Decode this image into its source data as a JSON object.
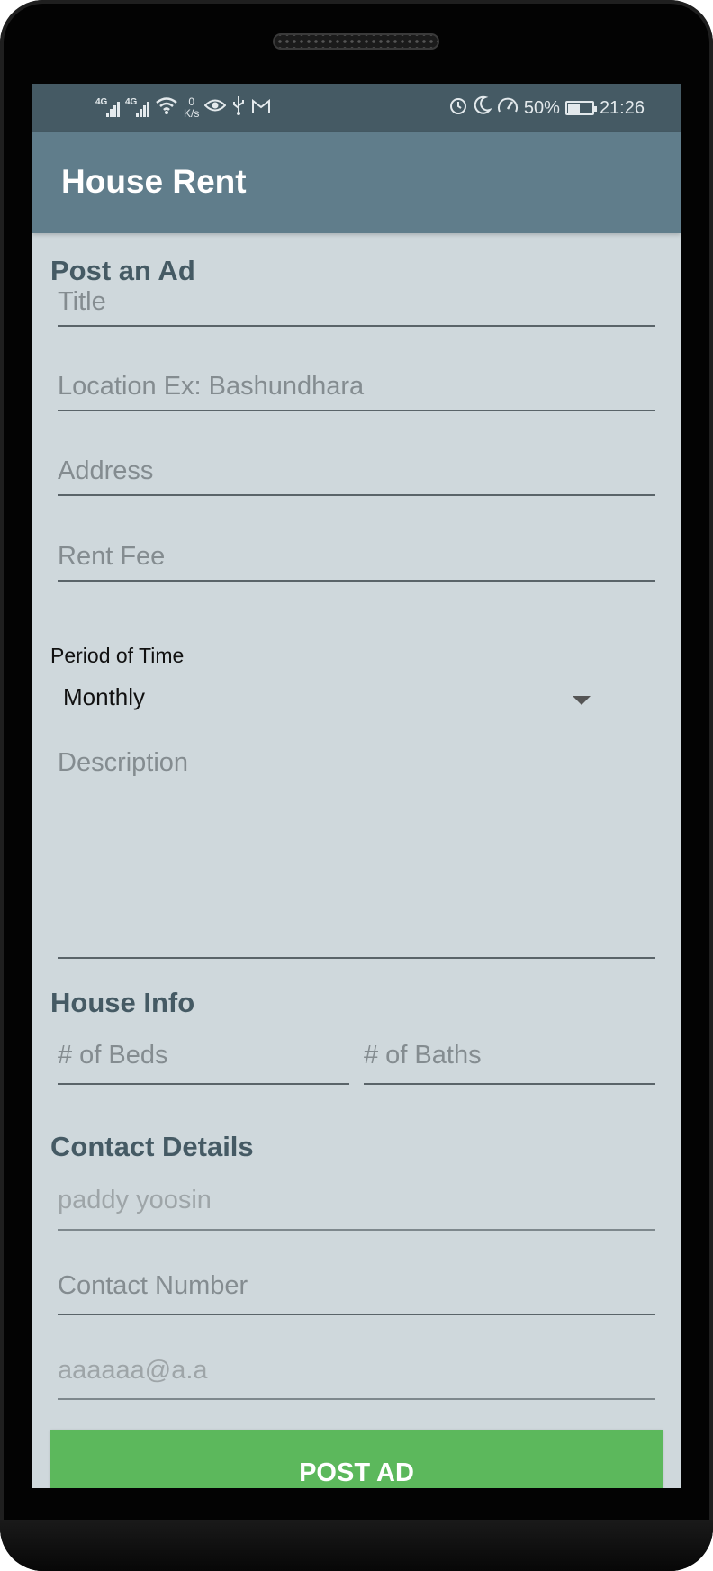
{
  "status_bar": {
    "net1": "4G",
    "net2": "4G",
    "speed_value": "0",
    "speed_unit": "K/s",
    "battery_percent": "50%",
    "battery_level": 0.5,
    "time": "21:26",
    "icons": [
      "signal-icon",
      "signal-icon",
      "wifi-icon",
      "eye-icon",
      "usb-icon",
      "gmail-icon",
      "alarm-icon",
      "moon-icon",
      "speedometer-icon",
      "battery-icon"
    ]
  },
  "app_bar": {
    "title": "House Rent"
  },
  "post_section": {
    "title": "Post an Ad",
    "title_placeholder": "Title",
    "location_placeholder": "Location Ex: Bashundhara",
    "address_placeholder": "Address",
    "rent_fee_placeholder": "Rent Fee",
    "period_label": "Period of Time",
    "period_value": "Monthly",
    "description_placeholder": "Description"
  },
  "house_info": {
    "title": "House Info",
    "beds_placeholder": "# of Beds",
    "baths_placeholder": "# of Baths"
  },
  "contact": {
    "title": "Contact Details",
    "name_hint": "paddy yoosin",
    "number_placeholder": "Contact Number",
    "email_hint": "aaaaaa@a.a"
  },
  "actions": {
    "post_label": "POST AD"
  },
  "colors": {
    "status_bar": "#455a64",
    "app_bar": "#607d8b",
    "background": "#cfd8dc",
    "section_title": "#455a64",
    "button": "#5cb85c"
  }
}
